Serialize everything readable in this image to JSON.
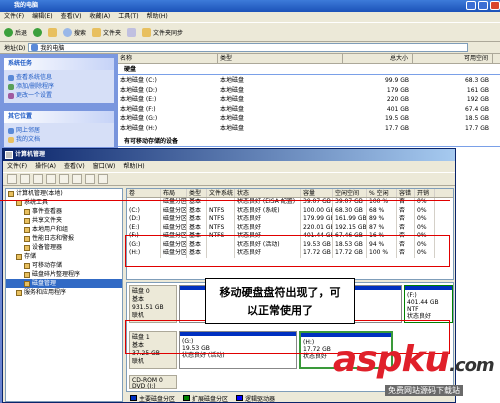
{
  "explorer": {
    "title": "我的电脑",
    "menu": [
      "文件(F)",
      "编辑(E)",
      "查看(V)",
      "收藏(A)",
      "工具(T)",
      "帮助(H)"
    ],
    "toolbar": {
      "back": "后退",
      "search": "搜索",
      "folders": "文件夹",
      "sync": "文件夹同步"
    },
    "address_label": "地址(D)",
    "address_value": "我的电脑",
    "tasks_title": "系统任务",
    "tasks": [
      "查看系统信息",
      "添加/删除程序",
      "更改一个设置"
    ],
    "other_title": "其它位置",
    "other": [
      "网上邻居",
      "我的文档"
    ],
    "columns": {
      "name": "名称",
      "type": "类型",
      "total": "总大小",
      "free": "可用空间"
    },
    "group_hdd": "硬盘",
    "group_removable": "有可移动存储的设备",
    "drives": [
      {
        "name": "本地磁盘 (C:)",
        "type": "本地磁盘",
        "total": "99.9 GB",
        "free": "68.3 GB"
      },
      {
        "name": "本地磁盘 (D:)",
        "type": "本地磁盘",
        "total": "179 GB",
        "free": "161 GB"
      },
      {
        "name": "本地磁盘 (E:)",
        "type": "本地磁盘",
        "total": "220 GB",
        "free": "192 GB"
      },
      {
        "name": "本地磁盘 (F:)",
        "type": "本地磁盘",
        "total": "401 GB",
        "free": "67.4 GB"
      },
      {
        "name": "本地磁盘 (G:)",
        "type": "本地磁盘",
        "total": "19.5 GB",
        "free": "18.5 GB"
      },
      {
        "name": "本地磁盘 (H:)",
        "type": "本地磁盘",
        "total": "17.7 GB",
        "free": "17.7 GB"
      }
    ]
  },
  "cm": {
    "title": "计算机管理",
    "menu": [
      "文件(F)",
      "操作(A)",
      "查看(V)",
      "窗口(W)",
      "帮助(H)"
    ],
    "tree": [
      {
        "label": "计算机管理(本地)",
        "indent": 0,
        "sel": false
      },
      {
        "label": "系统工具",
        "indent": 1,
        "sel": false
      },
      {
        "label": "事件查看器",
        "indent": 2,
        "sel": false
      },
      {
        "label": "共享文件夹",
        "indent": 2,
        "sel": false
      },
      {
        "label": "本地用户和组",
        "indent": 2,
        "sel": false
      },
      {
        "label": "性能日志和警报",
        "indent": 2,
        "sel": false
      },
      {
        "label": "设备管理器",
        "indent": 2,
        "sel": false
      },
      {
        "label": "存储",
        "indent": 1,
        "sel": false
      },
      {
        "label": "可移动存储",
        "indent": 2,
        "sel": false
      },
      {
        "label": "磁盘碎片整理程序",
        "indent": 2,
        "sel": false
      },
      {
        "label": "磁盘管理",
        "indent": 2,
        "sel": true
      },
      {
        "label": "服务和应用程序",
        "indent": 1,
        "sel": false
      }
    ],
    "vol_headers": [
      "卷",
      "布局",
      "类型",
      "文件系统",
      "状态",
      "容量",
      "空闲空间",
      "% 空闲",
      "容错",
      "开销"
    ],
    "volumes": [
      {
        "vol": "",
        "layout": "磁盘分区",
        "type": "基本",
        "fs": "",
        "status": "状态良好 (EISA 配置)",
        "cap": "39.07 GB",
        "free": "39.07 GB",
        "pct": "100 %",
        "ft": "否",
        "ov": "0%"
      },
      {
        "vol": "(C:)",
        "layout": "磁盘分区",
        "type": "基本",
        "fs": "NTFS",
        "status": "状态良好 (系统)",
        "cap": "100.00 GB",
        "free": "68.30 GB",
        "pct": "68 %",
        "ft": "否",
        "ov": "0%"
      },
      {
        "vol": "(D:)",
        "layout": "磁盘分区",
        "type": "基本",
        "fs": "NTFS",
        "status": "状态良好",
        "cap": "179.99 GB",
        "free": "161.99 GB",
        "pct": "89 %",
        "ft": "否",
        "ov": "0%"
      },
      {
        "vol": "(E:)",
        "layout": "磁盘分区",
        "type": "基本",
        "fs": "NTFS",
        "status": "状态良好",
        "cap": "220.01 GB",
        "free": "192.15 GB",
        "pct": "87 %",
        "ft": "否",
        "ov": "0%"
      },
      {
        "vol": "(F:)",
        "layout": "磁盘分区",
        "type": "基本",
        "fs": "NTFS",
        "status": "状态良好",
        "cap": "401.44 GB",
        "free": "67.46 GB",
        "pct": "16 %",
        "ft": "否",
        "ov": "0%"
      },
      {
        "vol": "(G:)",
        "layout": "磁盘分区",
        "type": "基本",
        "fs": "",
        "status": "状态良好 (活动)",
        "cap": "19.53 GB",
        "free": "18.53 GB",
        "pct": "94 %",
        "ft": "否",
        "ov": "0%"
      },
      {
        "vol": "(H:)",
        "layout": "磁盘分区",
        "type": "基本",
        "fs": "",
        "status": "状态良好",
        "cap": "17.72 GB",
        "free": "17.72 GB",
        "pct": "100 %",
        "ft": "否",
        "ov": "0%"
      }
    ],
    "disk0": {
      "name": "磁盘 0",
      "type": "基本",
      "size": "931.51 GB",
      "state": "联机",
      "right": "(F:)",
      "right_size": "401.44 GB NTF",
      "right_state": "状态良好"
    },
    "disk1": {
      "name": "磁盘 1",
      "type": "基本",
      "size": "37.25 GB",
      "state": "联机"
    },
    "disk1_parts": [
      {
        "name": "(G:)",
        "size": "19.53 GB",
        "status": "状态良好 (活动)"
      },
      {
        "name": "(H:)",
        "size": "17.72 GB",
        "status": "状态良好"
      }
    ],
    "cdrom": {
      "name": "CD-ROM 0",
      "type": "DVD (I:)"
    },
    "legend": [
      "主要磁盘分区",
      "扩展磁盘分区",
      "逻辑驱动器"
    ],
    "legend_colors": [
      "#0030c0",
      "#008000",
      "#0000ff"
    ]
  },
  "callout": {
    "line1": "移动硬盘盘符出现了，可",
    "line2": "以正常使用了"
  },
  "watermark": {
    "main": "aspku",
    "suffix": ".com",
    "sub": "免费网站源码下载站"
  }
}
